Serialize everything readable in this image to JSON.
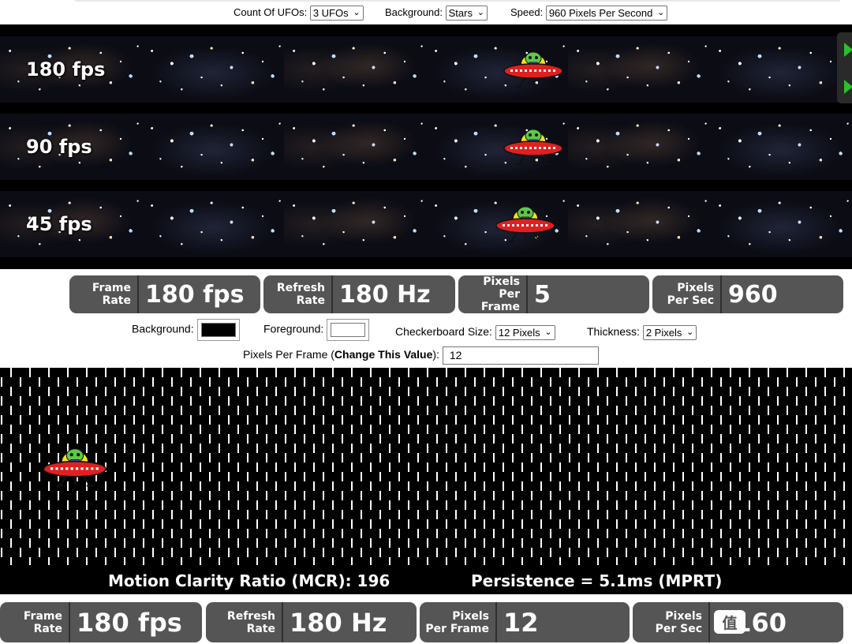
{
  "toolbar": {
    "ufo_count_label": "Count Of UFOs:",
    "ufo_count_value": "3 UFOs",
    "background_label": "Background:",
    "background_value": "Stars",
    "speed_label": "Speed:",
    "speed_value": "960 Pixels Per Second"
  },
  "lanes": [
    {
      "label": "180 fps"
    },
    {
      "label": "90 fps"
    },
    {
      "label": "45 fps"
    }
  ],
  "stats_top": {
    "frame_rate_label_1": "Frame",
    "frame_rate_label_2": "Rate",
    "frame_rate_value": "180 fps",
    "refresh_label_1": "Refresh",
    "refresh_label_2": "Rate",
    "refresh_value": "180 Hz",
    "ppf_label_1": "Pixels",
    "ppf_label_2": "Per Frame",
    "ppf_value": "5",
    "pps_label_1": "Pixels",
    "pps_label_2": "Per Sec",
    "pps_value": "960"
  },
  "settings": {
    "background_label": "Background:",
    "foreground_label": "Foreground:",
    "checker_label": "Checkerboard Size:",
    "checker_value": "12 Pixels",
    "thickness_label": "Thickness:",
    "thickness_value": "2 Pixels",
    "ppf_label_prefix": "Pixels Per Frame (",
    "ppf_label_bold": "Change This Value",
    "ppf_label_suffix": "):",
    "ppf_input_value": "12",
    "background_color": "#000000",
    "foreground_color": "#ffffff"
  },
  "track": {
    "mcr_text": "Motion Clarity Ratio (MCR): 196",
    "persistence_text": "Persistence = 5.1ms (MPRT)"
  },
  "stats_bottom": {
    "frame_rate_label_1": "Frame",
    "frame_rate_label_2": "Rate",
    "frame_rate_value": "180 fps",
    "refresh_label_1": "Refresh",
    "refresh_label_2": "Rate",
    "refresh_value": "180 Hz",
    "ppf_label_1": "Pixels",
    "ppf_label_2": "Per Frame",
    "ppf_value": "12",
    "pps_label_1": "Pixels",
    "pps_label_2": "Per Sec",
    "pps_value": "2160"
  },
  "watermark": {
    "text": "值"
  },
  "colors": {
    "ufo_saucer": "#e02020",
    "ufo_dome": "#f2e21a",
    "alien": "#5cc94a",
    "stat_box": "#555555",
    "scroll_arrow": "#29c02a"
  },
  "icons": {
    "ufo": "ufo-alien-icon",
    "select": "chevron-down-icon",
    "scroll": "play-arrow-icon"
  }
}
